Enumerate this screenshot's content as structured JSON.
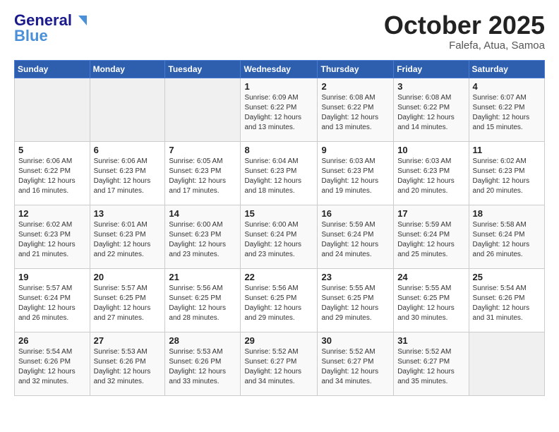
{
  "header": {
    "logo_general": "General",
    "logo_blue": "Blue",
    "month_title": "October 2025",
    "subtitle": "Falefa, Atua, Samoa"
  },
  "calendar": {
    "days_of_week": [
      "Sunday",
      "Monday",
      "Tuesday",
      "Wednesday",
      "Thursday",
      "Friday",
      "Saturday"
    ],
    "weeks": [
      [
        {
          "day": "",
          "info": ""
        },
        {
          "day": "",
          "info": ""
        },
        {
          "day": "",
          "info": ""
        },
        {
          "day": "1",
          "info": "Sunrise: 6:09 AM\nSunset: 6:22 PM\nDaylight: 12 hours\nand 13 minutes."
        },
        {
          "day": "2",
          "info": "Sunrise: 6:08 AM\nSunset: 6:22 PM\nDaylight: 12 hours\nand 13 minutes."
        },
        {
          "day": "3",
          "info": "Sunrise: 6:08 AM\nSunset: 6:22 PM\nDaylight: 12 hours\nand 14 minutes."
        },
        {
          "day": "4",
          "info": "Sunrise: 6:07 AM\nSunset: 6:22 PM\nDaylight: 12 hours\nand 15 minutes."
        }
      ],
      [
        {
          "day": "5",
          "info": "Sunrise: 6:06 AM\nSunset: 6:22 PM\nDaylight: 12 hours\nand 16 minutes."
        },
        {
          "day": "6",
          "info": "Sunrise: 6:06 AM\nSunset: 6:23 PM\nDaylight: 12 hours\nand 17 minutes."
        },
        {
          "day": "7",
          "info": "Sunrise: 6:05 AM\nSunset: 6:23 PM\nDaylight: 12 hours\nand 17 minutes."
        },
        {
          "day": "8",
          "info": "Sunrise: 6:04 AM\nSunset: 6:23 PM\nDaylight: 12 hours\nand 18 minutes."
        },
        {
          "day": "9",
          "info": "Sunrise: 6:03 AM\nSunset: 6:23 PM\nDaylight: 12 hours\nand 19 minutes."
        },
        {
          "day": "10",
          "info": "Sunrise: 6:03 AM\nSunset: 6:23 PM\nDaylight: 12 hours\nand 20 minutes."
        },
        {
          "day": "11",
          "info": "Sunrise: 6:02 AM\nSunset: 6:23 PM\nDaylight: 12 hours\nand 20 minutes."
        }
      ],
      [
        {
          "day": "12",
          "info": "Sunrise: 6:02 AM\nSunset: 6:23 PM\nDaylight: 12 hours\nand 21 minutes."
        },
        {
          "day": "13",
          "info": "Sunrise: 6:01 AM\nSunset: 6:23 PM\nDaylight: 12 hours\nand 22 minutes."
        },
        {
          "day": "14",
          "info": "Sunrise: 6:00 AM\nSunset: 6:23 PM\nDaylight: 12 hours\nand 23 minutes."
        },
        {
          "day": "15",
          "info": "Sunrise: 6:00 AM\nSunset: 6:24 PM\nDaylight: 12 hours\nand 23 minutes."
        },
        {
          "day": "16",
          "info": "Sunrise: 5:59 AM\nSunset: 6:24 PM\nDaylight: 12 hours\nand 24 minutes."
        },
        {
          "day": "17",
          "info": "Sunrise: 5:59 AM\nSunset: 6:24 PM\nDaylight: 12 hours\nand 25 minutes."
        },
        {
          "day": "18",
          "info": "Sunrise: 5:58 AM\nSunset: 6:24 PM\nDaylight: 12 hours\nand 26 minutes."
        }
      ],
      [
        {
          "day": "19",
          "info": "Sunrise: 5:57 AM\nSunset: 6:24 PM\nDaylight: 12 hours\nand 26 minutes."
        },
        {
          "day": "20",
          "info": "Sunrise: 5:57 AM\nSunset: 6:25 PM\nDaylight: 12 hours\nand 27 minutes."
        },
        {
          "day": "21",
          "info": "Sunrise: 5:56 AM\nSunset: 6:25 PM\nDaylight: 12 hours\nand 28 minutes."
        },
        {
          "day": "22",
          "info": "Sunrise: 5:56 AM\nSunset: 6:25 PM\nDaylight: 12 hours\nand 29 minutes."
        },
        {
          "day": "23",
          "info": "Sunrise: 5:55 AM\nSunset: 6:25 PM\nDaylight: 12 hours\nand 29 minutes."
        },
        {
          "day": "24",
          "info": "Sunrise: 5:55 AM\nSunset: 6:25 PM\nDaylight: 12 hours\nand 30 minutes."
        },
        {
          "day": "25",
          "info": "Sunrise: 5:54 AM\nSunset: 6:26 PM\nDaylight: 12 hours\nand 31 minutes."
        }
      ],
      [
        {
          "day": "26",
          "info": "Sunrise: 5:54 AM\nSunset: 6:26 PM\nDaylight: 12 hours\nand 32 minutes."
        },
        {
          "day": "27",
          "info": "Sunrise: 5:53 AM\nSunset: 6:26 PM\nDaylight: 12 hours\nand 32 minutes."
        },
        {
          "day": "28",
          "info": "Sunrise: 5:53 AM\nSunset: 6:26 PM\nDaylight: 12 hours\nand 33 minutes."
        },
        {
          "day": "29",
          "info": "Sunrise: 5:52 AM\nSunset: 6:27 PM\nDaylight: 12 hours\nand 34 minutes."
        },
        {
          "day": "30",
          "info": "Sunrise: 5:52 AM\nSunset: 6:27 PM\nDaylight: 12 hours\nand 34 minutes."
        },
        {
          "day": "31",
          "info": "Sunrise: 5:52 AM\nSunset: 6:27 PM\nDaylight: 12 hours\nand 35 minutes."
        },
        {
          "day": "",
          "info": ""
        }
      ]
    ]
  }
}
